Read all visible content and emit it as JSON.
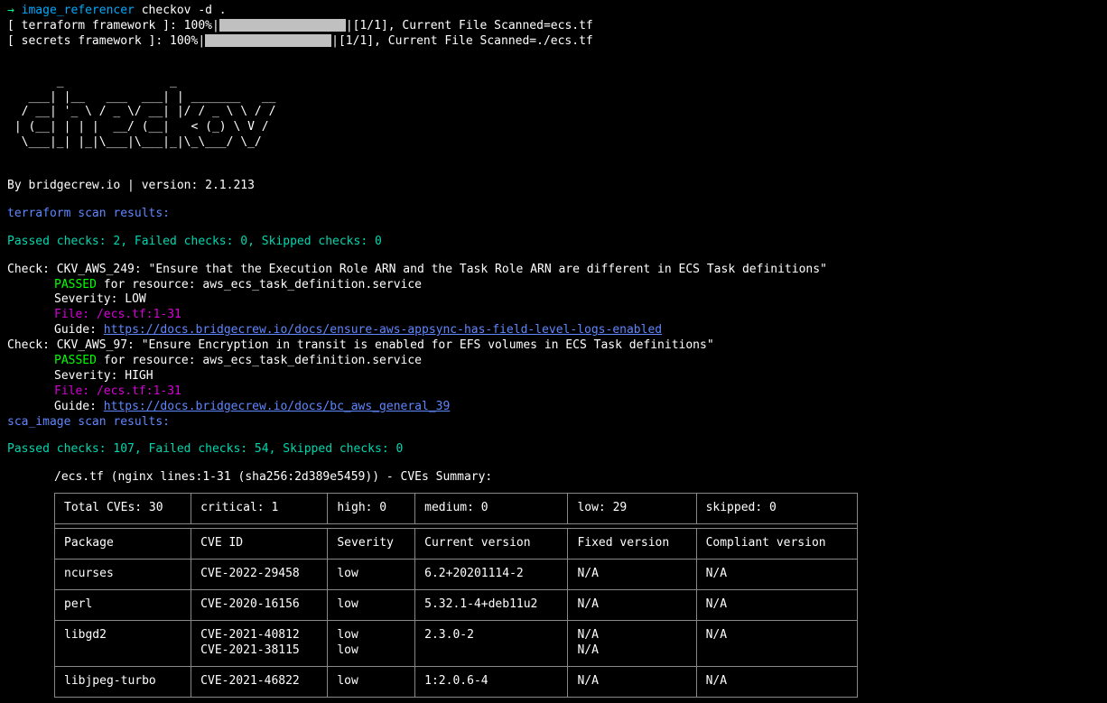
{
  "prompt": {
    "arrow": "→",
    "path": "image_referencer",
    "command": "checkov -d ."
  },
  "progress": {
    "terraform": "[ terraform framework ]: 100%|",
    "terraform_suffix": "|[1/1], Current File Scanned=ecs.tf",
    "secrets": "[ secrets framework ]: 100%|",
    "secrets_suffix": "|[1/1], Current File Scanned=./ecs.tf"
  },
  "ascii_logo": "       _               _              \n   ___| |__   ___  ___| | _______   __\n  / __| '_ \\ / _ \\/ __| |/ / _ \\ \\ / /\n | (__| | | |  __/ (__|   < (_) \\ V / \n  \\___|_| |_|\\___|\\___|_|\\_\\___/ \\_/  \n                                      ",
  "byline": "By bridgecrew.io | version: 2.1.213",
  "terraform_section": {
    "header": "terraform scan results:",
    "summary": "Passed checks: 2, Failed checks: 0, Skipped checks: 0"
  },
  "checks": [
    {
      "title": "Check: CKV_AWS_249: \"Ensure that the Execution Role ARN and the Task Role ARN are different in ECS Task definitions\"",
      "status_prefix": "PASSED",
      "status_suffix": " for resource: aws_ecs_task_definition.service",
      "severity": "Severity: LOW",
      "file_label": "File: ",
      "file_path": "/ecs.tf:1-31",
      "guide_label": "Guide: ",
      "guide_url": "https://docs.bridgecrew.io/docs/ensure-aws-appsync-has-field-level-logs-enabled"
    },
    {
      "title": "Check: CKV_AWS_97: \"Ensure Encryption in transit is enabled for EFS volumes in ECS Task definitions\"",
      "status_prefix": "PASSED",
      "status_suffix": " for resource: aws_ecs_task_definition.service",
      "severity": "Severity: HIGH",
      "file_label": "File: ",
      "file_path": "/ecs.tf:1-31",
      "guide_label": "Guide: ",
      "guide_url": "https://docs.bridgecrew.io/docs/bc_aws_general_39"
    }
  ],
  "sca_section": {
    "header": "sca_image scan results:",
    "summary": "Passed checks: 107, Failed checks: 54, Skipped checks: 0"
  },
  "cve_summary": {
    "header": "/ecs.tf (nginx lines:1-31 (sha256:2d389e5459)) - CVEs Summary:",
    "totals": {
      "total": "Total CVEs: 30",
      "critical": "critical: 1",
      "high": "high: 0",
      "medium": "medium: 0",
      "low": "low: 29",
      "skipped": "skipped: 0"
    },
    "columns": {
      "package": "Package",
      "cve_id": "CVE ID",
      "severity": "Severity",
      "current": "Current version",
      "fixed": "Fixed version",
      "compliant": "Compliant version"
    },
    "rows": [
      {
        "package": "ncurses",
        "cve_id": "CVE-2022-29458",
        "severity": "low",
        "current": "6.2+20201114-2",
        "fixed": "N/A",
        "compliant": "N/A"
      },
      {
        "package": "perl",
        "cve_id": "CVE-2020-16156",
        "severity": "low",
        "current": "5.32.1-4+deb11u2",
        "fixed": "N/A",
        "compliant": "N/A"
      },
      {
        "package": "libgd2",
        "cve_id": "CVE-2021-40812\nCVE-2021-38115",
        "severity": "low\nlow",
        "current": "2.3.0-2",
        "fixed": "N/A\nN/A",
        "compliant": "N/A"
      },
      {
        "package": "libjpeg-turbo",
        "cve_id": "CVE-2021-46822",
        "severity": "low",
        "current": "1:2.0.6-4",
        "fixed": "N/A",
        "compliant": "N/A"
      }
    ]
  }
}
